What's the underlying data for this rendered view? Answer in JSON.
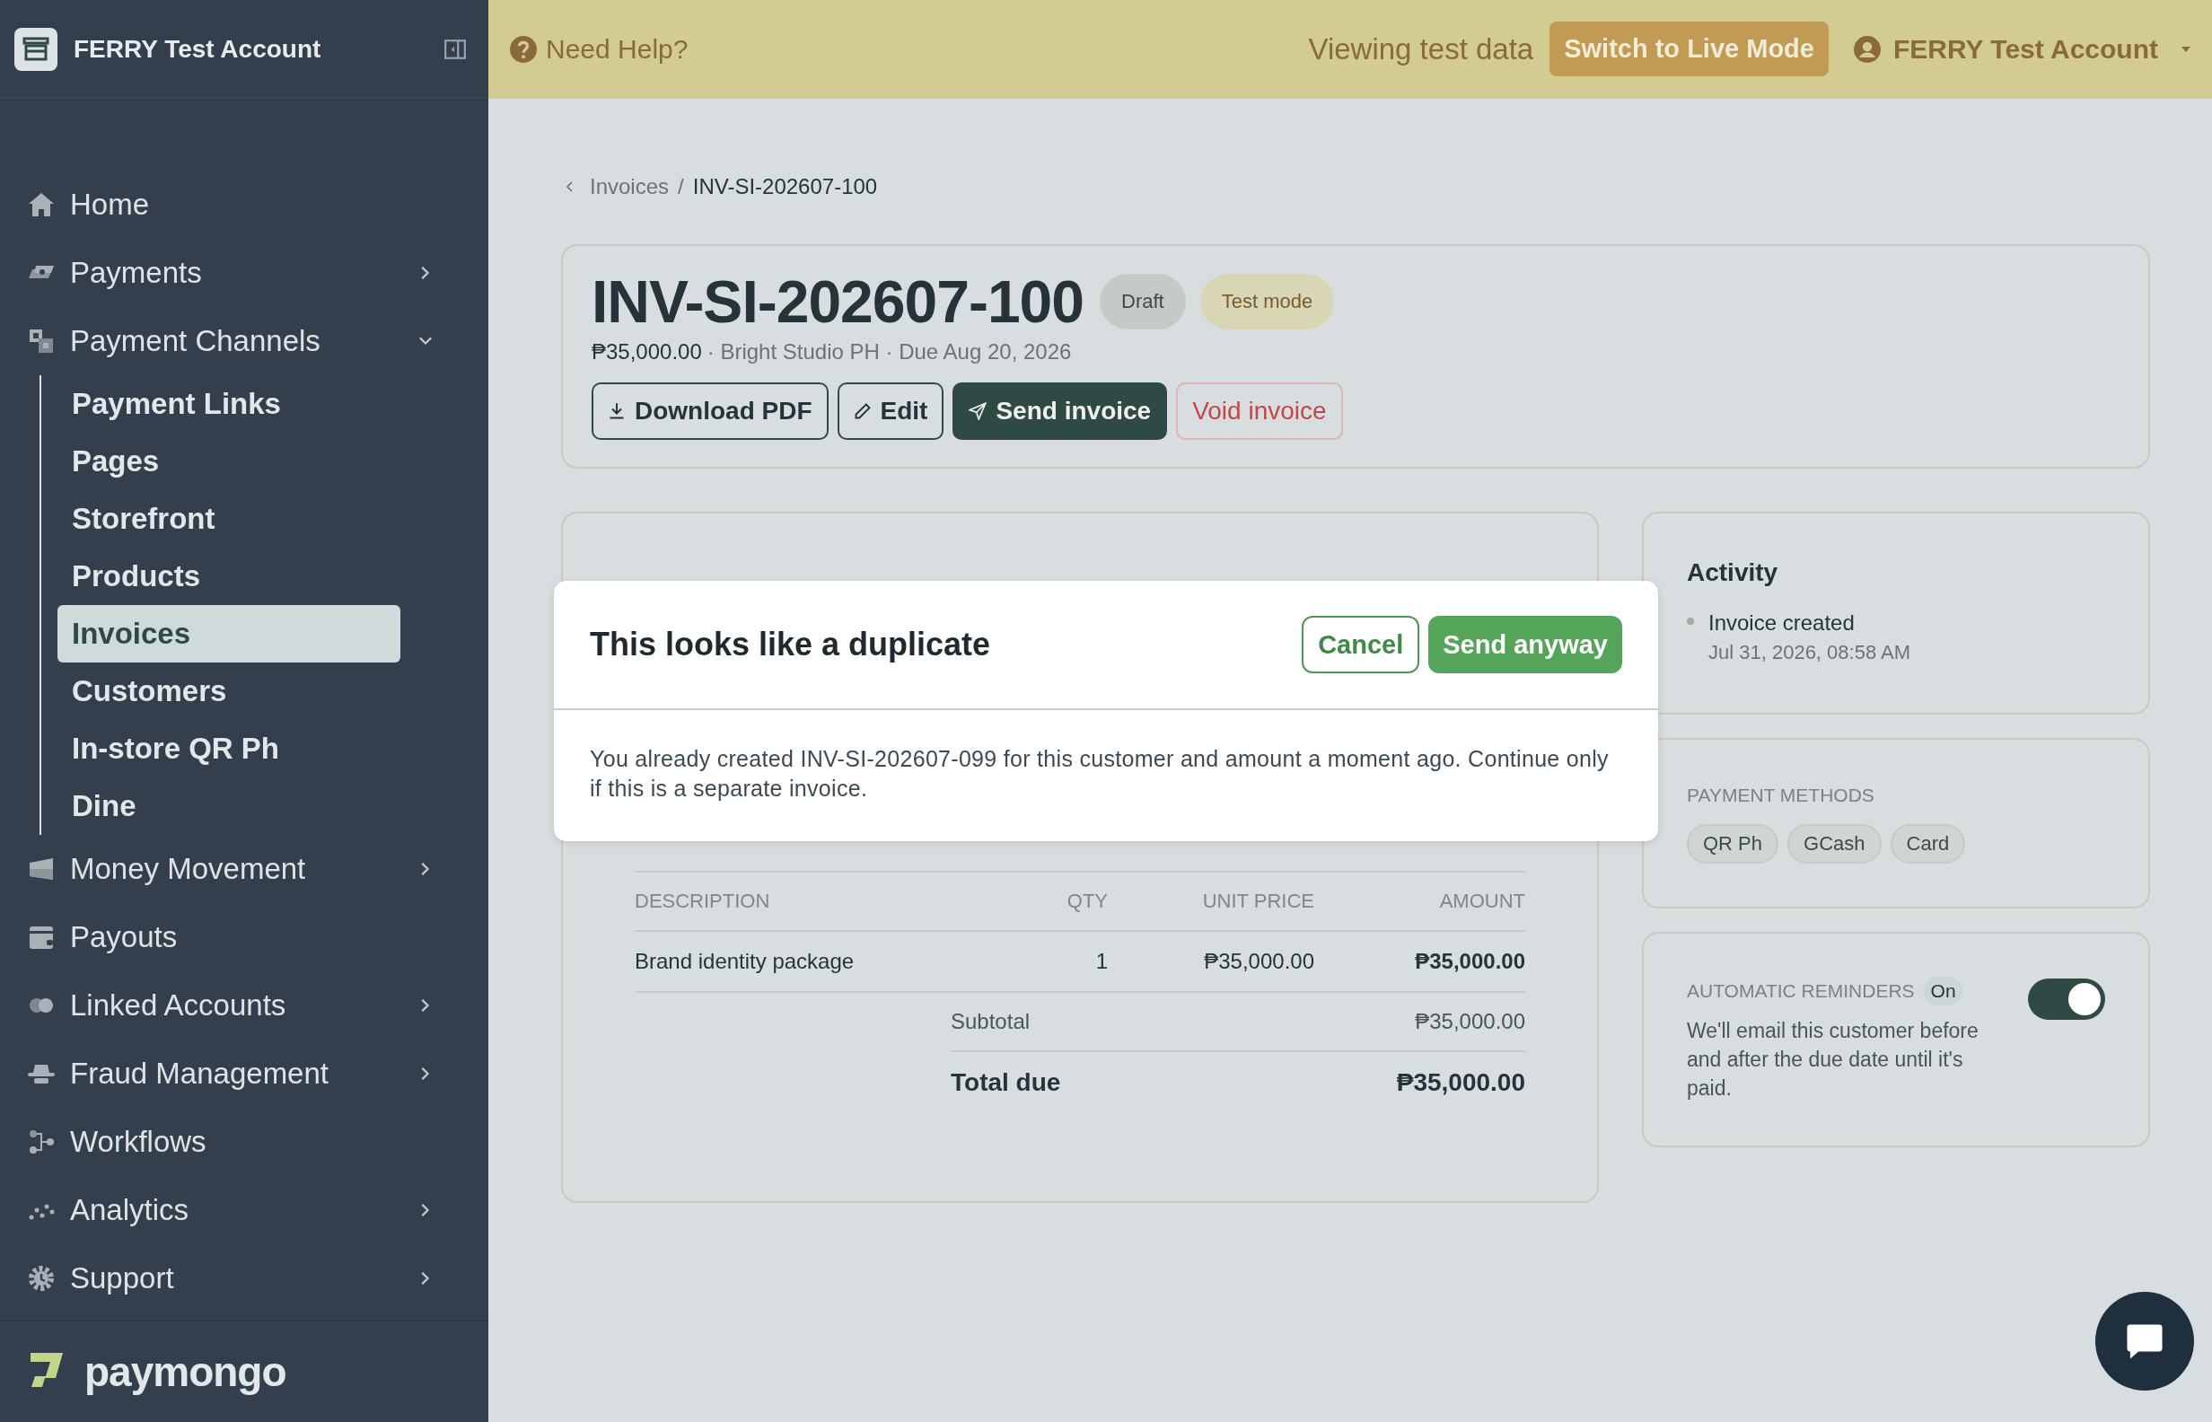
{
  "sidebar": {
    "account_name": "FERRY Test Account",
    "items": [
      {
        "label": "Home",
        "kind": "link"
      },
      {
        "label": "Payments",
        "kind": "group",
        "expanded": false
      },
      {
        "label": "Payment Channels",
        "kind": "group",
        "expanded": true,
        "children": [
          {
            "label": "Payment Links",
            "selected": false
          },
          {
            "label": "Pages",
            "selected": false
          },
          {
            "label": "Storefront",
            "selected": false
          },
          {
            "label": "Products",
            "selected": false
          },
          {
            "label": "Invoices",
            "selected": true
          },
          {
            "label": "Customers",
            "selected": false
          },
          {
            "label": "In-store QR Ph",
            "selected": false
          },
          {
            "label": "Dine",
            "selected": false
          }
        ]
      },
      {
        "label": "Money Movement",
        "kind": "group",
        "expanded": false
      },
      {
        "label": "Payouts",
        "kind": "link"
      },
      {
        "label": "Linked Accounts",
        "kind": "group",
        "expanded": false
      },
      {
        "label": "Fraud Management",
        "kind": "group",
        "expanded": false
      },
      {
        "label": "Workflows",
        "kind": "link"
      },
      {
        "label": "Analytics",
        "kind": "group",
        "expanded": false
      },
      {
        "label": "Support",
        "kind": "group",
        "expanded": false
      }
    ],
    "brand": "paymongo"
  },
  "topbar": {
    "help": "Need Help?",
    "mode_notice": "Viewing test data",
    "switch_button": "Switch to Live Mode",
    "account": "FERRY Test Account"
  },
  "breadcrumb": {
    "parent": "Invoices",
    "separator": "/",
    "current": "INV-SI-202607-100"
  },
  "invoice": {
    "number": "INV-SI-202607-100",
    "badges": [
      {
        "label": "Draft",
        "kind": "status"
      },
      {
        "label": "Test mode",
        "kind": "mode"
      }
    ],
    "amount": "₱35,000.00",
    "meta": "· Bright Studio PH · Due Aug 20, 2026",
    "actions": [
      {
        "label": "Download PDF",
        "kind": "outline"
      },
      {
        "label": "Edit",
        "kind": "outline"
      },
      {
        "label": "Send invoice",
        "kind": "primary"
      },
      {
        "label": "Void invoice",
        "kind": "danger"
      }
    ]
  },
  "details": {
    "columns": [
      "DESCRIPTION",
      "QTY",
      "UNIT PRICE",
      "AMOUNT"
    ],
    "rows": [
      [
        "Brand identity package",
        "1",
        "₱35,000.00",
        "₱35,000.00"
      ]
    ],
    "subtotal_label": "Subtotal",
    "subtotal": "₱35,000.00",
    "total_label": "Total due",
    "total": "₱35,000.00"
  },
  "activity": {
    "title": "Activity",
    "events": [
      {
        "text": "Invoice created",
        "time": "Jul 31, 2026, 08:58 AM"
      }
    ]
  },
  "payment_methods": {
    "title": "PAYMENT METHODS",
    "methods": [
      "QR Ph",
      "GCash",
      "Card"
    ]
  },
  "reminders": {
    "title": "AUTOMATIC REMINDERS",
    "status": "On",
    "on": true,
    "description": "We'll email this customer before and after the due date until it's paid."
  },
  "dialog": {
    "title": "This looks like a duplicate",
    "cancel": "Cancel",
    "confirm": "Send anyway",
    "message": "You already created INV-SI-202607-099 for this customer and amount a moment ago. Continue only if this is a separate invoice."
  }
}
